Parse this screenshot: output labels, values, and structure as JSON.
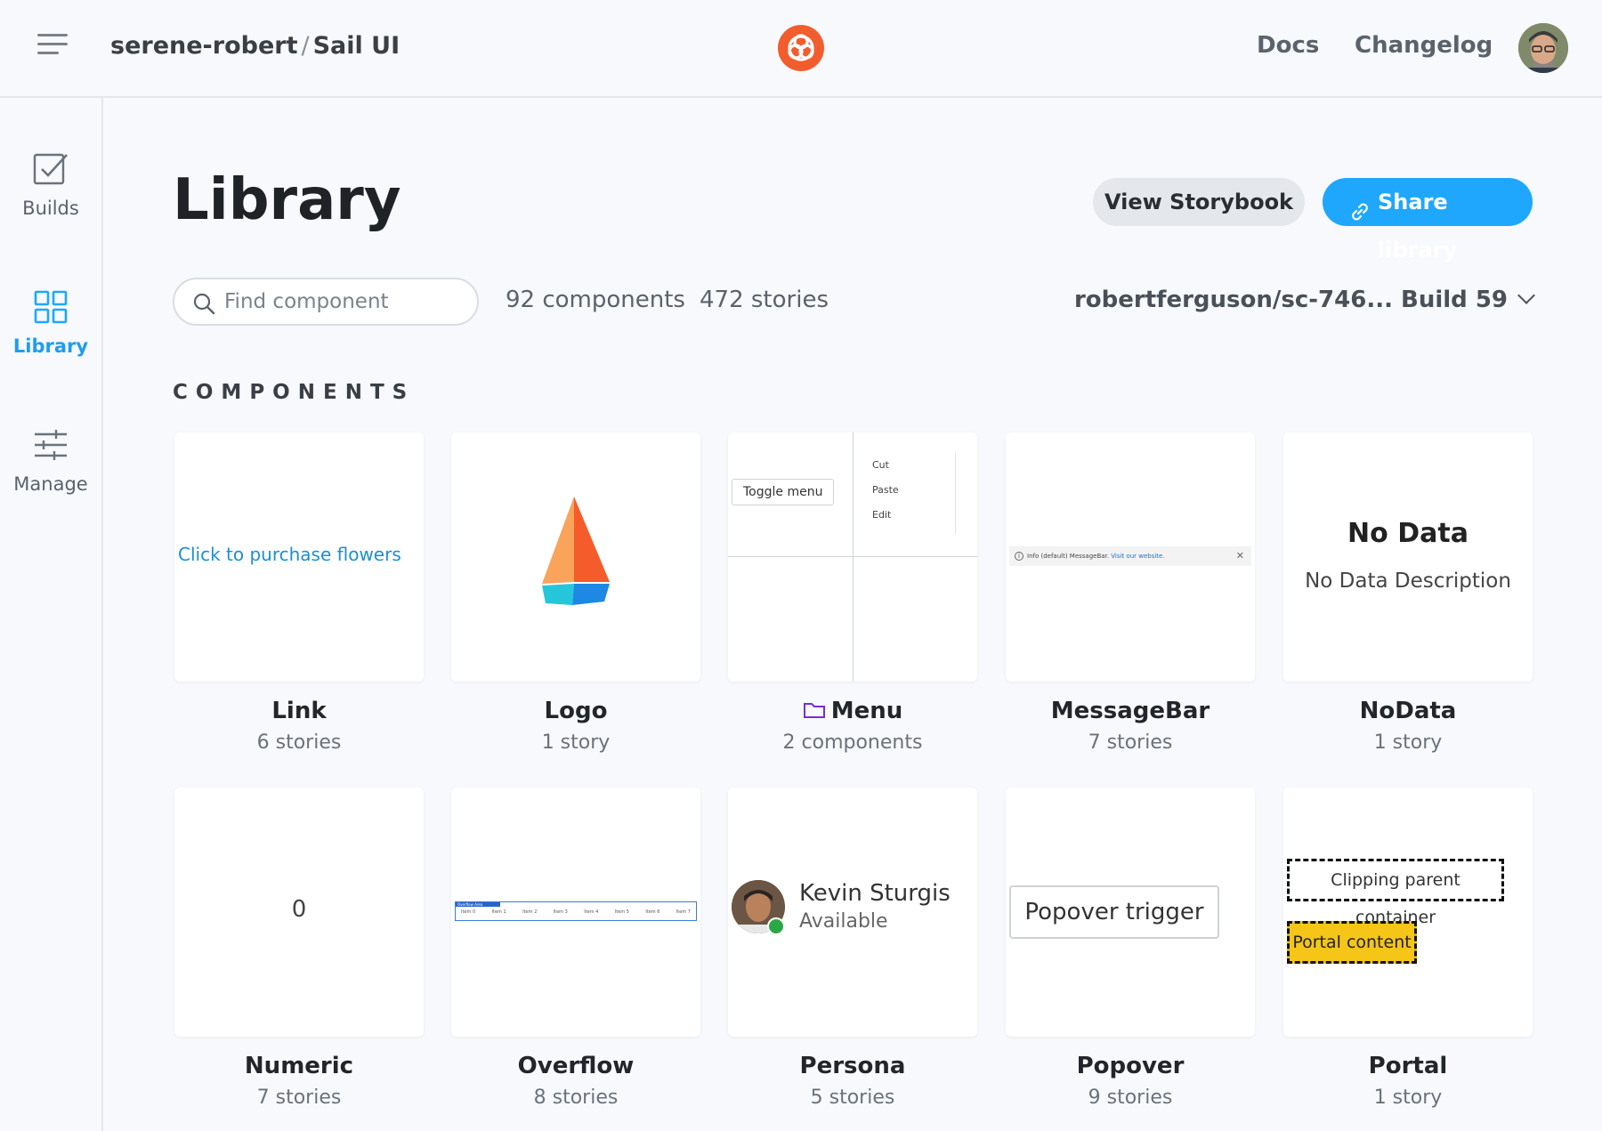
{
  "header": {
    "org": "serene-robert",
    "separator": "/",
    "project": "Sail UI",
    "nav": {
      "docs": "Docs",
      "changelog": "Changelog"
    },
    "brand_color": "#F25D2E"
  },
  "sidebar": {
    "items": [
      {
        "label": "Builds",
        "icon": "checkbox-icon",
        "active": false
      },
      {
        "label": "Library",
        "icon": "grid-icon",
        "active": true
      },
      {
        "label": "Manage",
        "icon": "sliders-icon",
        "active": false
      }
    ],
    "accent_color": "#1EA7FD"
  },
  "main": {
    "title": "Library",
    "actions": {
      "view_storybook": "View Storybook",
      "share_library": "Share library"
    },
    "search": {
      "placeholder": "Find component",
      "value": ""
    },
    "counts": {
      "components": "92 components",
      "stories": "472 stories"
    },
    "build_selector": "robertferguson/sc-746... Build 59",
    "section_label": "COMPONENTS",
    "components": [
      {
        "name": "Link",
        "meta": "6 stories",
        "preview": {
          "link_text": "Click to purchase flowers"
        }
      },
      {
        "name": "Logo",
        "meta": "1 story"
      },
      {
        "name": "Menu",
        "meta": "2 components",
        "is_folder": true,
        "preview": {
          "toggle": "Toggle menu",
          "items": [
            "Cut",
            "Paste",
            "Edit"
          ]
        }
      },
      {
        "name": "MessageBar",
        "meta": "7 stories",
        "preview": {
          "text": "Info (default) MessageBar.",
          "link": "Visit our website."
        }
      },
      {
        "name": "NoData",
        "meta": "1 story",
        "preview": {
          "title": "No Data",
          "description": "No Data Description"
        }
      },
      {
        "name": "Numeric",
        "meta": "7 stories",
        "preview": {
          "value": "0"
        }
      },
      {
        "name": "Overflow",
        "meta": "8 stories",
        "preview": {
          "header": "Overflow Area",
          "items": [
            "Item 0",
            "Item 1",
            "Item 2",
            "Item 3",
            "Item 4",
            "Item 5",
            "Item 6",
            "Item 7"
          ]
        }
      },
      {
        "name": "Persona",
        "meta": "5 stories",
        "preview": {
          "name": "Kevin Sturgis",
          "status": "Available"
        }
      },
      {
        "name": "Popover",
        "meta": "9 stories",
        "preview": {
          "trigger": "Popover trigger"
        }
      },
      {
        "name": "Portal",
        "meta": "1 story",
        "preview": {
          "container": "Clipping parent container",
          "content": "Portal content"
        }
      }
    ]
  }
}
